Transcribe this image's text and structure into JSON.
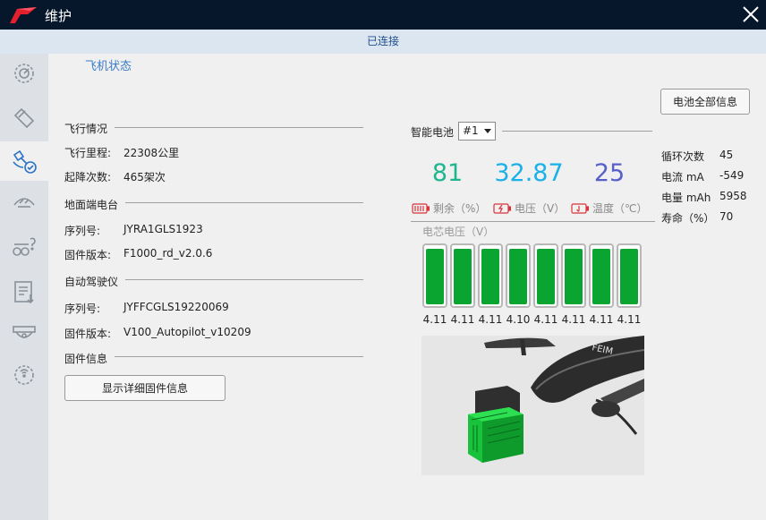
{
  "window": {
    "title": "维护"
  },
  "connection": {
    "status": "已连接"
  },
  "tab": {
    "title": "飞机状态"
  },
  "sidebar": {
    "items": [
      {
        "icon": "dashboard-gear-icon",
        "active": false
      },
      {
        "icon": "tag-icon",
        "active": false
      },
      {
        "icon": "satellite-check-icon",
        "active": true
      },
      {
        "icon": "motor-icon",
        "active": false
      },
      {
        "icon": "drone-help-icon",
        "active": false
      },
      {
        "icon": "log-download-icon",
        "active": false
      },
      {
        "icon": "pod-icon",
        "active": false
      },
      {
        "icon": "wireless-gear-icon",
        "active": false
      }
    ]
  },
  "flight": {
    "section_title": "飞行情况",
    "mileage_label": "飞行里程:",
    "mileage_value": "22308公里",
    "landings_label": "起降次数:",
    "landings_value": "465架次"
  },
  "ground_station": {
    "section_title": "地面端电台",
    "serial_label": "序列号:",
    "serial_value": "JYRA1GLS1923",
    "firmware_label": "固件版本:",
    "firmware_value": "F1000_rd_v2.0.6"
  },
  "autopilot": {
    "section_title": "自动驾驶仪",
    "serial_label": "序列号:",
    "serial_value": "JYFFCGLS19220069",
    "firmware_label": "固件版本:",
    "firmware_value": "V100_Autopilot_v10209"
  },
  "firmware_info": {
    "section_title": "固件信息",
    "button_label": "显示详细固件信息"
  },
  "battery": {
    "all_info_button": "电池全部信息",
    "section_title": "智能电池",
    "selected": "#1",
    "remaining_value": "81",
    "remaining_label": "剩余（%）",
    "voltage_value": "32.87",
    "voltage_label": "电压（V）",
    "temp_value": "25",
    "temp_label": "温度（℃）",
    "cell_title": "电芯电压（V）",
    "cells": [
      "4.11",
      "4.11",
      "4.11",
      "4.10",
      "4.11",
      "4.11",
      "4.11",
      "4.11"
    ],
    "cell_fill_fraction": 0.97,
    "stats": {
      "cycles_label": "循环次数",
      "cycles_value": "45",
      "current_label": "电流 mA",
      "current_value": "-549",
      "capacity_label": "电量 mAh",
      "capacity_value": "5958",
      "life_label": "寿命（%）",
      "life_value": "70"
    },
    "colors": {
      "remaining": "#1fb58f",
      "voltage": "#1ab0e8",
      "temp": "#5860c8",
      "cell_fill": "#0aa531",
      "warn_icon": "#d9323a"
    }
  },
  "drone_image": {
    "brand_text": "FEIM"
  }
}
